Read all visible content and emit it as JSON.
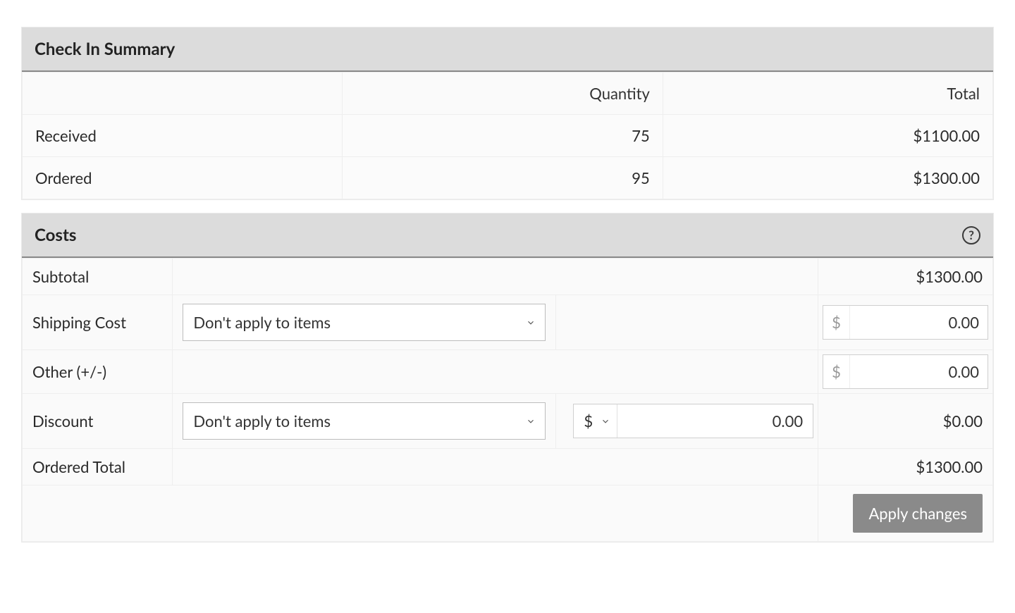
{
  "checkin": {
    "title": "Check In Summary",
    "columns": {
      "quantity": "Quantity",
      "total": "Total"
    },
    "rows": {
      "received": {
        "label": "Received",
        "qty": "75",
        "total": "$1100.00"
      },
      "ordered": {
        "label": "Ordered",
        "qty": "95",
        "total": "$1300.00"
      }
    }
  },
  "costs": {
    "title": "Costs",
    "help_tooltip": "?",
    "rows": {
      "subtotal": {
        "label": "Subtotal",
        "value": "$1300.00"
      },
      "shipping": {
        "label": "Shipping Cost",
        "apply_option": "Don't apply to items",
        "currency": "$",
        "value": "0.00"
      },
      "other": {
        "label": "Other (+/-)",
        "currency": "$",
        "value": "0.00"
      },
      "discount": {
        "label": "Discount",
        "apply_option": "Don't apply to items",
        "unit": "$",
        "input_value": "0.00",
        "total": "$0.00"
      },
      "ordered_total": {
        "label": "Ordered Total",
        "value": "$1300.00"
      }
    },
    "apply_button": "Apply changes"
  }
}
